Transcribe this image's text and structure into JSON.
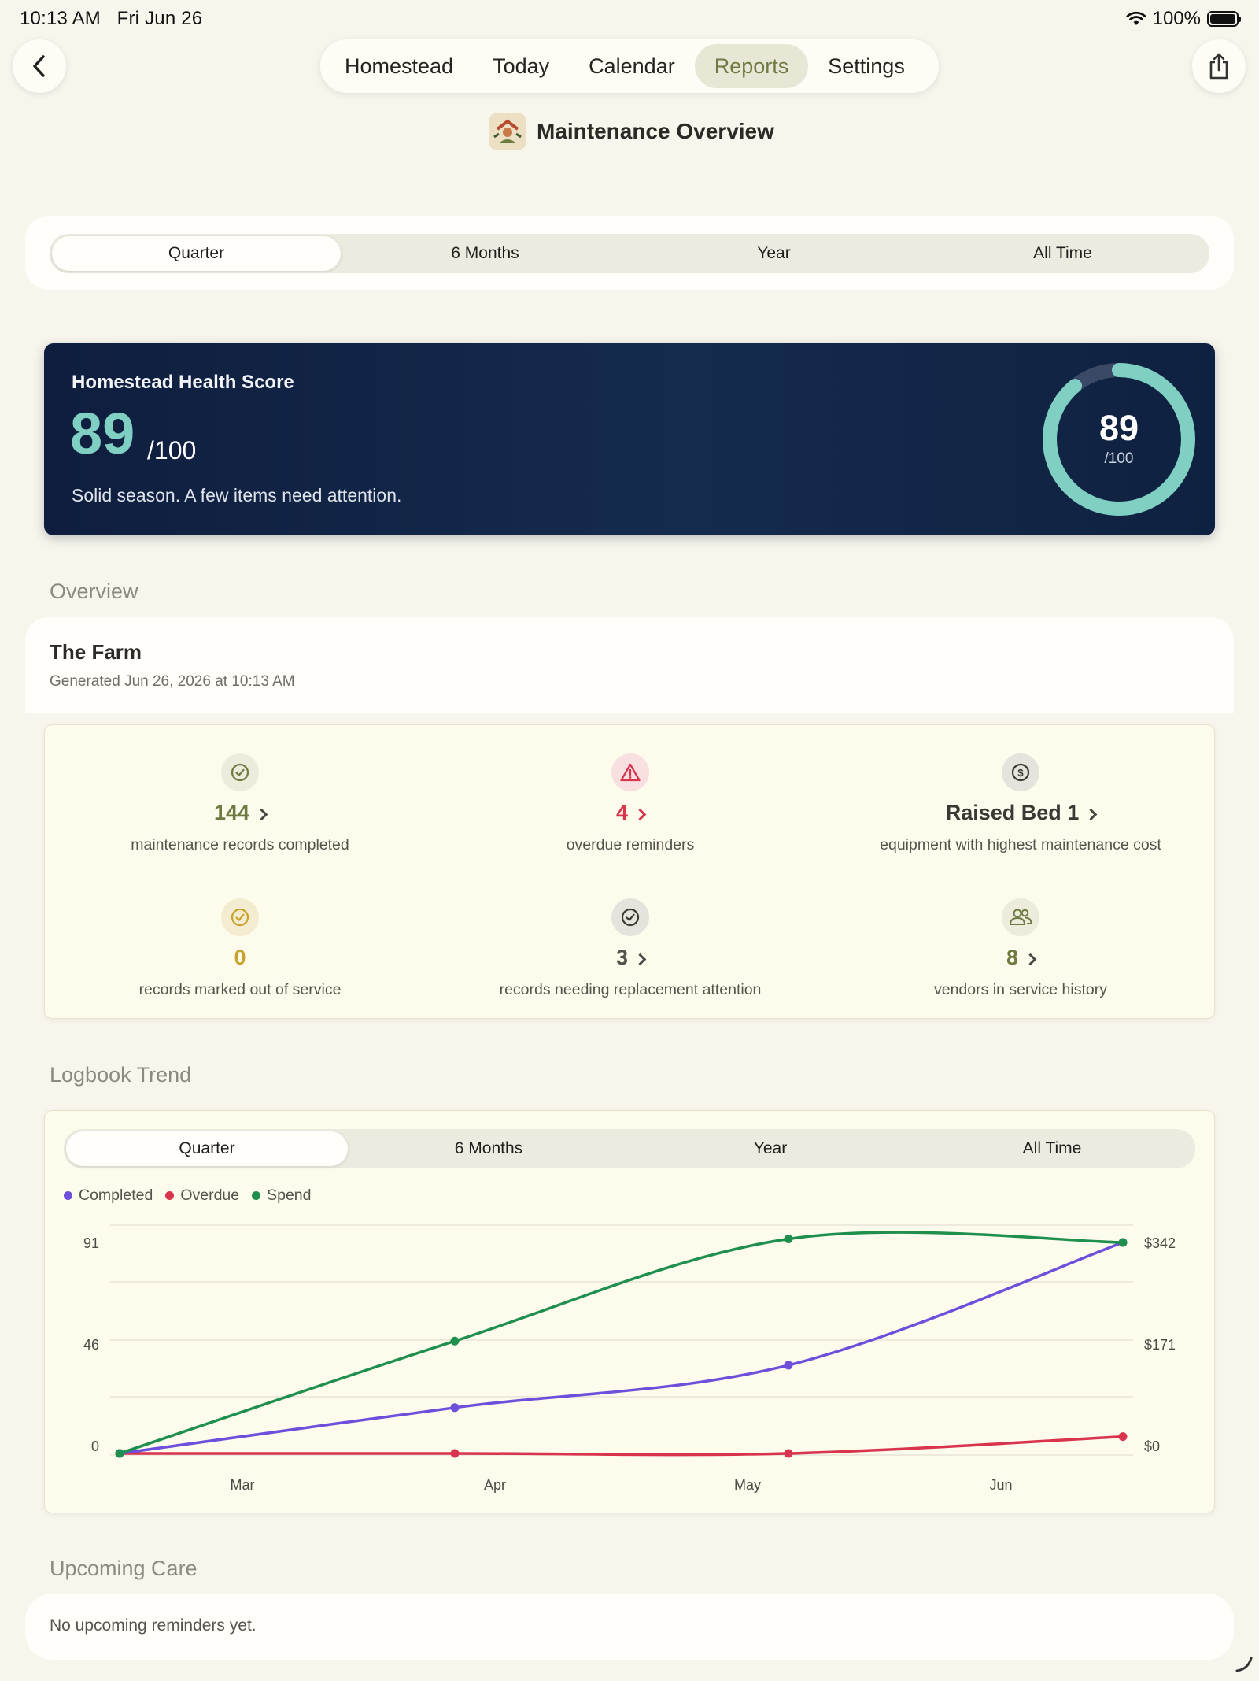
{
  "status": {
    "time": "10:13 AM",
    "date": "Fri Jun 26",
    "battery": "100%"
  },
  "nav": {
    "tabs": [
      "Homestead",
      "Today",
      "Calendar",
      "Reports",
      "Settings"
    ],
    "active": "Reports"
  },
  "page": {
    "title": "Maintenance Overview"
  },
  "period_filter": {
    "options": [
      "Quarter",
      "6 Months",
      "Year",
      "All Time"
    ],
    "selected": "Quarter"
  },
  "health": {
    "title": "Homestead Health Score",
    "score": "89",
    "max": "/100",
    "message": "Solid season. A few items need attention.",
    "ring_value": 89,
    "accent": "#7fcfc2"
  },
  "overview": {
    "heading": "Overview",
    "farm_name": "The Farm",
    "generated": "Generated Jun 26, 2026 at 10:13 AM",
    "stats": [
      {
        "value": "144",
        "label": "maintenance records completed",
        "icon": "check-circle-icon",
        "color": "#6f7a42",
        "chevron": true
      },
      {
        "value": "4",
        "label": "overdue reminders",
        "icon": "warning-triangle-icon",
        "color": "#d9344e",
        "chevron": true
      },
      {
        "value": "Raised Bed 1",
        "label": "equipment with highest maintenance cost",
        "icon": "dollar-circle-icon",
        "color": "#3a3934",
        "chevron": true
      },
      {
        "value": "0",
        "label": "records marked out of service",
        "icon": "check-circle-icon",
        "color": "#c9a22e",
        "chevron": false
      },
      {
        "value": "3",
        "label": "records needing replacement attention",
        "icon": "check-circle-icon",
        "color": "#55534c",
        "chevron": true
      },
      {
        "value": "8",
        "label": "vendors in service history",
        "icon": "people-icon",
        "color": "#6f7a42",
        "chevron": true
      }
    ]
  },
  "trend": {
    "heading": "Logbook Trend",
    "options": [
      "Quarter",
      "6 Months",
      "Year",
      "All Time"
    ],
    "selected": "Quarter"
  },
  "chart_data": {
    "type": "line",
    "x": [
      "Mar",
      "Apr",
      "May",
      "Jun"
    ],
    "left_ticks": [
      "91",
      "46",
      "0"
    ],
    "right_ticks": [
      "$342",
      "$171",
      "$0"
    ],
    "left_ylim": [
      0,
      91
    ],
    "right_ylim": [
      0,
      342
    ],
    "series": [
      {
        "name": "Completed",
        "color": "#6d4fdc",
        "axis": "left",
        "values": [
          0,
          17,
          36,
          91
        ]
      },
      {
        "name": "Overdue",
        "color": "#d9344e",
        "axis": "left",
        "values": [
          0,
          0,
          0,
          4
        ]
      },
      {
        "name": "Spend",
        "color": "#1f8f4e",
        "axis": "right",
        "values": [
          0,
          176,
          348,
          342
        ]
      }
    ],
    "grid": true,
    "legend": "top-left"
  },
  "upcoming": {
    "heading": "Upcoming Care",
    "empty": "No upcoming reminders yet."
  }
}
